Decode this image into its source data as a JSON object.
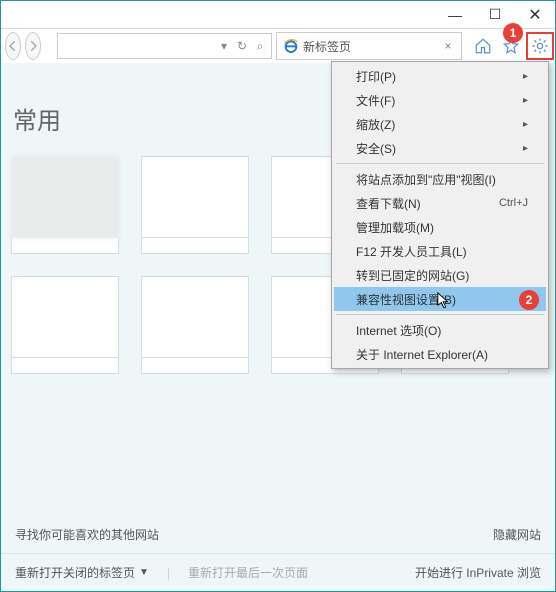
{
  "window": {
    "minimize": "—",
    "maximize": "☐",
    "close": "✕"
  },
  "toolbar": {
    "address": "",
    "search_icon": "⌕",
    "refresh_icon": "↻",
    "dropdown_icon": "▾"
  },
  "tab": {
    "title": "新标签页",
    "close": "×"
  },
  "content": {
    "heading": "常用"
  },
  "bottom": {
    "discover": "寻找你可能喜欢的其他网站",
    "hide": "隐藏网站",
    "reopen": "重新打开关闭的标签页",
    "reopen_last": "重新打开最后一次页面",
    "inprivate": "开始进行 InPrivate 浏览"
  },
  "menu": {
    "items": [
      {
        "label": "打印(P)",
        "sub": true
      },
      {
        "label": "文件(F)",
        "sub": true
      },
      {
        "label": "缩放(Z)",
        "sub": true
      },
      {
        "label": "安全(S)",
        "sub": true
      },
      {
        "divider": true
      },
      {
        "label": "将站点添加到\"应用\"视图(I)"
      },
      {
        "label": "查看下载(N)",
        "shortcut": "Ctrl+J"
      },
      {
        "label": "管理加载项(M)"
      },
      {
        "label": "F12 开发人员工具(L)"
      },
      {
        "label": "转到已固定的网站(G)"
      },
      {
        "label": "兼容性视图设置(B)",
        "highlight": true
      },
      {
        "divider": true
      },
      {
        "label": "Internet 选项(O)"
      },
      {
        "label": "关于 Internet Explorer(A)"
      }
    ]
  },
  "callouts": {
    "c1": "1",
    "c2": "2"
  }
}
